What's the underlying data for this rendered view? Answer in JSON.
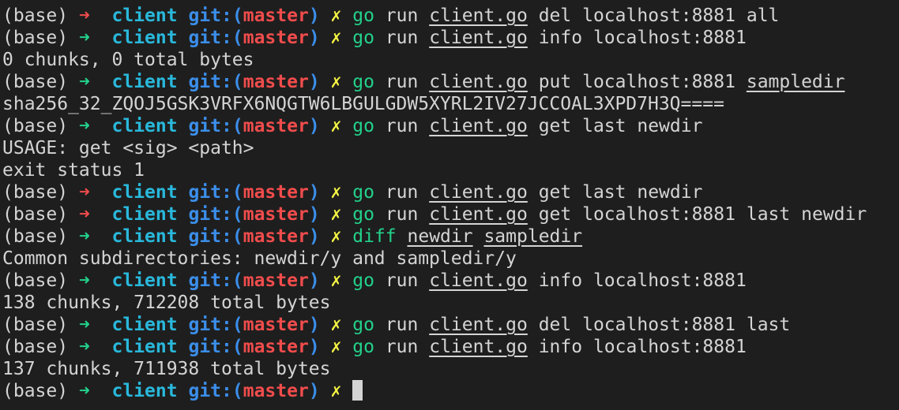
{
  "colors": {
    "background": "#1e1e1e",
    "foreground": "#d4d4d4",
    "arrow_success": "#23d18b",
    "arrow_error": "#f14c4c",
    "directory": "#29b8db",
    "git_label": "#3b8eea",
    "branch": "#f14c4c",
    "dirty_mark": "#f5f543",
    "command": "#23d18b"
  },
  "lines": [
    {
      "type": "output",
      "text": "exit status 1"
    },
    {
      "type": "prompt",
      "env": "(base)",
      "arrow": "➜",
      "status": "error",
      "dir": "client",
      "git_open": "git:(",
      "branch": "master",
      "git_close": ")",
      "dirty": "✗",
      "command": "go",
      "args": [
        {
          "text": "run",
          "u": false
        },
        {
          "text": "client.go",
          "u": true
        },
        {
          "text": "del",
          "u": false
        },
        {
          "text": "localhost:8881",
          "u": false
        },
        {
          "text": "all",
          "u": false
        }
      ]
    },
    {
      "type": "prompt",
      "env": "(base)",
      "arrow": "➜",
      "status": "success",
      "dir": "client",
      "git_open": "git:(",
      "branch": "master",
      "git_close": ")",
      "dirty": "✗",
      "command": "go",
      "args": [
        {
          "text": "run",
          "u": false
        },
        {
          "text": "client.go",
          "u": true
        },
        {
          "text": "info",
          "u": false
        },
        {
          "text": "localhost:8881",
          "u": false
        }
      ]
    },
    {
      "type": "output",
      "text": "0 chunks, 0 total bytes"
    },
    {
      "type": "prompt",
      "env": "(base)",
      "arrow": "➜",
      "status": "success",
      "dir": "client",
      "git_open": "git:(",
      "branch": "master",
      "git_close": ")",
      "dirty": "✗",
      "command": "go",
      "args": [
        {
          "text": "run",
          "u": false
        },
        {
          "text": "client.go",
          "u": true
        },
        {
          "text": "put",
          "u": false
        },
        {
          "text": "localhost:8881",
          "u": false
        },
        {
          "text": "sampledir",
          "u": true
        }
      ]
    },
    {
      "type": "output",
      "text": "sha256_32_ZQOJ5GSK3VRFX6NQGTW6LBGULGDW5XYRL2IV27JCCOAL3XPD7H3Q===="
    },
    {
      "type": "prompt",
      "env": "(base)",
      "arrow": "➜",
      "status": "success",
      "dir": "client",
      "git_open": "git:(",
      "branch": "master",
      "git_close": ")",
      "dirty": "✗",
      "command": "go",
      "args": [
        {
          "text": "run",
          "u": false
        },
        {
          "text": "client.go",
          "u": true
        },
        {
          "text": "get",
          "u": false
        },
        {
          "text": "last",
          "u": false
        },
        {
          "text": "newdir",
          "u": false
        }
      ]
    },
    {
      "type": "output",
      "text": "USAGE: get <sig> <path>"
    },
    {
      "type": "output",
      "text": "exit status 1"
    },
    {
      "type": "prompt",
      "env": "(base)",
      "arrow": "➜",
      "status": "error",
      "dir": "client",
      "git_open": "git:(",
      "branch": "master",
      "git_close": ")",
      "dirty": "✗",
      "command": "go",
      "args": [
        {
          "text": "run",
          "u": false
        },
        {
          "text": "client.go",
          "u": true
        },
        {
          "text": "get",
          "u": false
        },
        {
          "text": "last",
          "u": false
        },
        {
          "text": "newdir",
          "u": false
        }
      ]
    },
    {
      "type": "prompt",
      "env": "(base)",
      "arrow": "➜",
      "status": "error",
      "dir": "client",
      "git_open": "git:(",
      "branch": "master",
      "git_close": ")",
      "dirty": "✗",
      "command": "go",
      "args": [
        {
          "text": "run",
          "u": false
        },
        {
          "text": "client.go",
          "u": true
        },
        {
          "text": "get",
          "u": false
        },
        {
          "text": "localhost:8881",
          "u": false
        },
        {
          "text": "last",
          "u": false
        },
        {
          "text": "newdir",
          "u": false
        }
      ]
    },
    {
      "type": "prompt",
      "env": "(base)",
      "arrow": "➜",
      "status": "success",
      "dir": "client",
      "git_open": "git:(",
      "branch": "master",
      "git_close": ")",
      "dirty": "✗",
      "command": "diff",
      "args": [
        {
          "text": "newdir",
          "u": true
        },
        {
          "text": "sampledir",
          "u": true
        }
      ]
    },
    {
      "type": "output",
      "text": "Common subdirectories: newdir/y and sampledir/y"
    },
    {
      "type": "prompt",
      "env": "(base)",
      "arrow": "➜",
      "status": "success",
      "dir": "client",
      "git_open": "git:(",
      "branch": "master",
      "git_close": ")",
      "dirty": "✗",
      "command": "go",
      "args": [
        {
          "text": "run",
          "u": false
        },
        {
          "text": "client.go",
          "u": true
        },
        {
          "text": "info",
          "u": false
        },
        {
          "text": "localhost:8881",
          "u": false
        }
      ]
    },
    {
      "type": "output",
      "text": "138 chunks, 712208 total bytes"
    },
    {
      "type": "prompt",
      "env": "(base)",
      "arrow": "➜",
      "status": "success",
      "dir": "client",
      "git_open": "git:(",
      "branch": "master",
      "git_close": ")",
      "dirty": "✗",
      "command": "go",
      "args": [
        {
          "text": "run",
          "u": false
        },
        {
          "text": "client.go",
          "u": true
        },
        {
          "text": "del",
          "u": false
        },
        {
          "text": "localhost:8881",
          "u": false
        },
        {
          "text": "last",
          "u": false
        }
      ]
    },
    {
      "type": "prompt",
      "env": "(base)",
      "arrow": "➜",
      "status": "success",
      "dir": "client",
      "git_open": "git:(",
      "branch": "master",
      "git_close": ")",
      "dirty": "✗",
      "command": "go",
      "args": [
        {
          "text": "run",
          "u": false
        },
        {
          "text": "client.go",
          "u": true
        },
        {
          "text": "info",
          "u": false
        },
        {
          "text": "localhost:8881",
          "u": false
        }
      ]
    },
    {
      "type": "output",
      "text": "137 chunks, 711938 total bytes"
    },
    {
      "type": "prompt",
      "env": "(base)",
      "arrow": "➜",
      "status": "success",
      "dir": "client",
      "git_open": "git:(",
      "branch": "master",
      "git_close": ")",
      "dirty": "✗",
      "command": "",
      "args": [],
      "cursor": true
    }
  ]
}
